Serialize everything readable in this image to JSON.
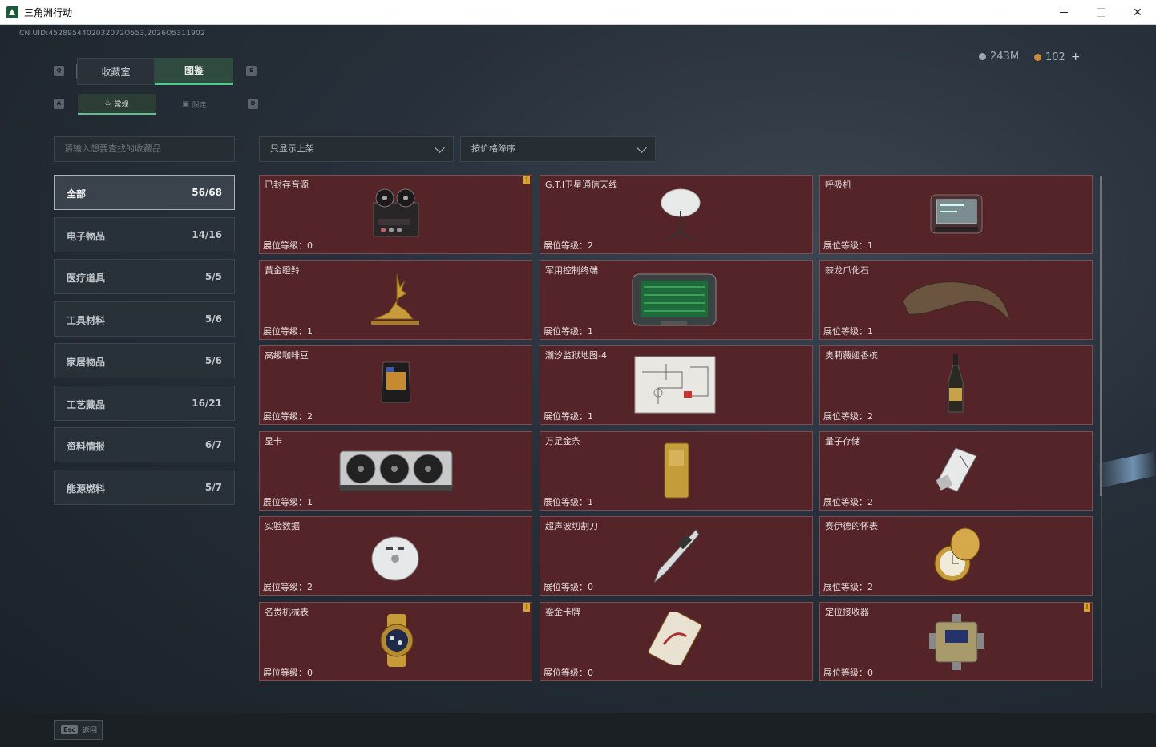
{
  "window": {
    "title": "三角洲行动"
  },
  "uid": "CN UID:4528954402032072O553,2026O5311902",
  "currency": {
    "silver": "243M",
    "gold": "102",
    "add": "+"
  },
  "keys": {
    "q": "Q",
    "e": "E",
    "a": "A",
    "d": "D",
    "esc": "Esc"
  },
  "tabs": {
    "collection_room": "收藏室",
    "catalog": "图鉴"
  },
  "subtabs": {
    "regular": "常规",
    "limited": "限定"
  },
  "search": {
    "placeholder": "请输入想要查找的收藏品"
  },
  "filters": {
    "shelf": "只显示上架",
    "sort": "按价格降序"
  },
  "categories": [
    {
      "label": "全部",
      "count": "56/68",
      "active": true
    },
    {
      "label": "电子物品",
      "count": "14/16"
    },
    {
      "label": "医疗道具",
      "count": "5/5"
    },
    {
      "label": "工具材料",
      "count": "5/6"
    },
    {
      "label": "家居物品",
      "count": "5/6"
    },
    {
      "label": "工艺藏品",
      "count": "16/21"
    },
    {
      "label": "资料情报",
      "count": "6/7"
    },
    {
      "label": "能源燃料",
      "count": "5/7"
    }
  ],
  "items": [
    {
      "name": "已封存音源",
      "level": "展位等级：0",
      "badge": "!",
      "icon": "reel-recorder-icon"
    },
    {
      "name": "G.T.I卫星通信天线",
      "level": "展位等级：2",
      "icon": "satellite-antenna-icon"
    },
    {
      "name": "呼吸机",
      "level": "展位等级：1",
      "icon": "ventilator-icon"
    },
    {
      "name": "黄金瞪羚",
      "level": "展位等级：1",
      "icon": "gold-gazelle-icon"
    },
    {
      "name": "军用控制终端",
      "level": "展位等级：1",
      "icon": "control-terminal-icon"
    },
    {
      "name": "棘龙爪化石",
      "level": "展位等级：1",
      "icon": "claw-fossil-icon"
    },
    {
      "name": "高级咖啡豆",
      "level": "展位等级：2",
      "icon": "coffee-bag-icon"
    },
    {
      "name": "潮汐监狱地图-4",
      "level": "展位等级：1",
      "icon": "map-sheet-icon"
    },
    {
      "name": "奥莉薇娅香槟",
      "level": "展位等级：2",
      "icon": "champagne-icon"
    },
    {
      "name": "显卡",
      "level": "展位等级：1",
      "icon": "graphics-card-icon"
    },
    {
      "name": "万足金条",
      "level": "展位等级：1",
      "icon": "gold-bar-icon"
    },
    {
      "name": "量子存储",
      "level": "展位等级：2",
      "icon": "quantum-storage-icon"
    },
    {
      "name": "实验数据",
      "level": "展位等级：2",
      "icon": "data-disc-icon"
    },
    {
      "name": "超声波切割刀",
      "level": "展位等级：0",
      "icon": "ultrasonic-knife-icon"
    },
    {
      "name": "赛伊德的怀表",
      "level": "展位等级：2",
      "icon": "pocket-watch-icon"
    },
    {
      "name": "名贵机械表",
      "level": "展位等级：0",
      "badge": "!",
      "icon": "wristwatch-icon"
    },
    {
      "name": "鎏金卡牌",
      "level": "展位等级：0",
      "icon": "gilded-card-icon"
    },
    {
      "name": "定位接收器",
      "level": "展位等级：0",
      "badge": "!",
      "icon": "gps-receiver-icon"
    }
  ],
  "footer": {
    "back": "返回"
  }
}
